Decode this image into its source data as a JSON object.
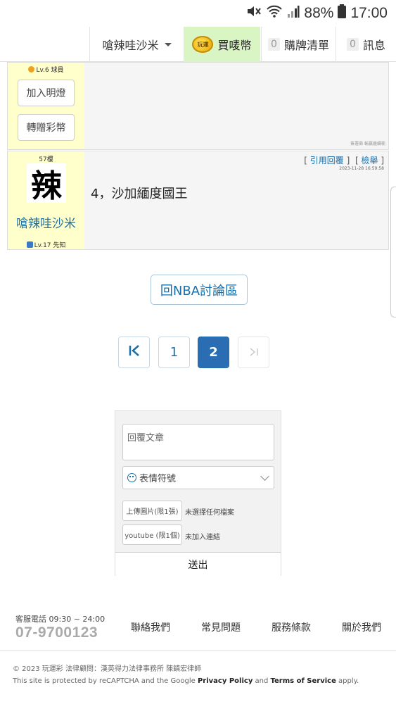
{
  "status_bar": {
    "battery": "88%",
    "time": "17:00"
  },
  "nav": {
    "user_name": "嗆辣哇沙米",
    "coin_label": "買唛幣",
    "coin_icon_text": "玩運",
    "list_count": "0",
    "list_label": "購牌清單",
    "msg_count": "0",
    "msg_label": "訊息"
  },
  "post1": {
    "level": "Lv.6 球員",
    "btn_light": "加入明燈",
    "btn_gift": "轉贈彩幣",
    "signature": "簽署衝 輸贏繼續衝"
  },
  "post2": {
    "floor": "57樓",
    "avatar_char": "辣",
    "user": "嗆辣哇沙米",
    "level": "Lv.17 先知",
    "quote_reply": "引用回覆",
    "report": "檢舉",
    "time": "2023-11-28 16:59:58",
    "body": "4，沙加緬度國王"
  },
  "back_label": "回NBA討論區",
  "pagination": {
    "first": "I<",
    "pages": [
      "1",
      "2"
    ],
    "last": ">I",
    "current": "2"
  },
  "reply": {
    "placeholder": "回覆文章",
    "emoji_label": "表情符號",
    "upload_img": "上傳圖片(限1張)",
    "upload_img_note": "未選擇任何檔案",
    "youtube": "youtube (限1個)",
    "youtube_note": "未加入連結",
    "send": "送出"
  },
  "footer": {
    "hotline_label": "客服電話 09:30 ~ 24:00",
    "hotline_number": "07-9700123",
    "links": [
      "聯絡我們",
      "常見問題",
      "服務條款",
      "關於我們"
    ],
    "copyright": "© 2023 玩運彩 法律顧問：漢英得力法律事務所 陳鎮宏律師",
    "recaptcha_pre": "This site is protected by reCAPTCHA and the Google ",
    "privacy": "Privacy Policy",
    "and": " and ",
    "terms": "Terms of Service",
    "apply": " apply."
  }
}
